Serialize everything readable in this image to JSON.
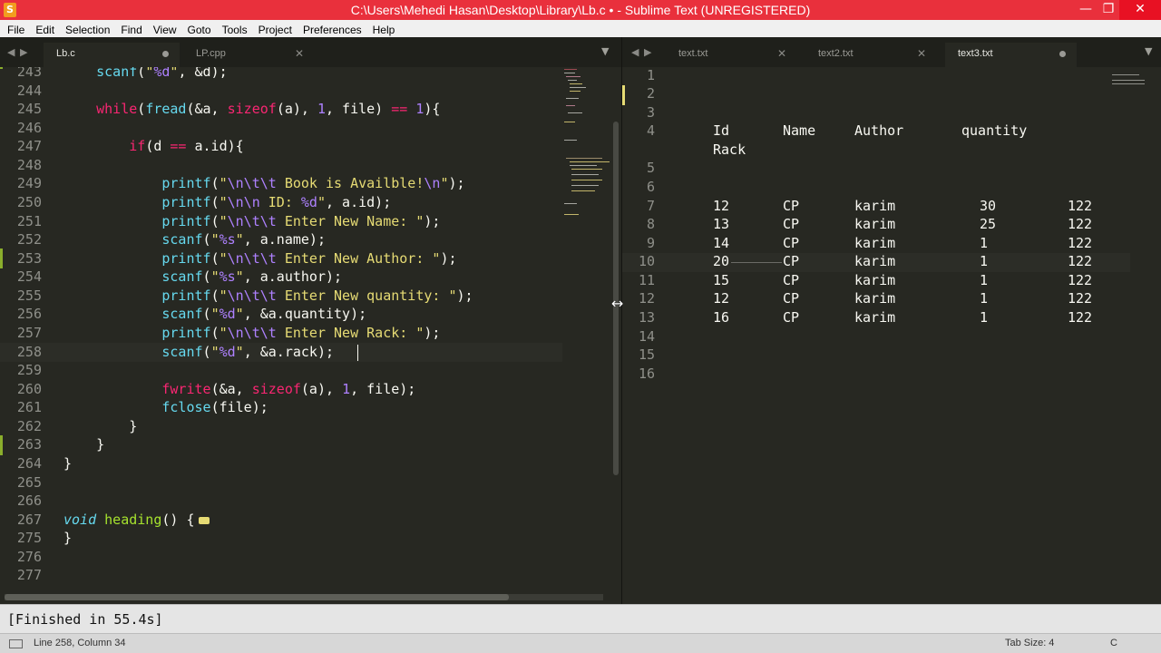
{
  "window": {
    "title": "C:\\Users\\Mehedi Hasan\\Desktop\\Library\\Lb.c • - Sublime Text (UNREGISTERED)",
    "app_icon": "S",
    "minimize": "—",
    "maximize": "❐",
    "close": "✕"
  },
  "menu": [
    "File",
    "Edit",
    "Selection",
    "Find",
    "View",
    "Goto",
    "Tools",
    "Project",
    "Preferences",
    "Help"
  ],
  "left_group": {
    "nav_prev": "◀",
    "nav_next": "▶",
    "dropdown": "▼",
    "tabs": [
      {
        "label": "Lb.c",
        "active": true,
        "dirty": true
      },
      {
        "label": "LP.cpp",
        "active": false,
        "dirty": false
      }
    ]
  },
  "right_group": {
    "nav_prev": "◀",
    "nav_next": "▶",
    "dropdown": "▼",
    "tabs": [
      {
        "label": "text.txt",
        "active": false,
        "dirty": false
      },
      {
        "label": "text2.txt",
        "active": false,
        "dirty": false
      },
      {
        "label": "text3.txt",
        "active": true,
        "dirty": true
      }
    ]
  },
  "left_editor": {
    "line_numbers": [
      "243",
      "244",
      "245",
      "246",
      "247",
      "248",
      "249",
      "250",
      "251",
      "252",
      "253",
      "254",
      "255",
      "256",
      "257",
      "258",
      "259",
      "260",
      "261",
      "262",
      "263",
      "264",
      "265",
      "266",
      "267",
      "275",
      "276",
      "277"
    ],
    "current_line": "258"
  },
  "right_editor": {
    "line_numbers": [
      "1",
      "2",
      "3",
      "4",
      "5",
      "6",
      "7",
      "8",
      "9",
      "10",
      "11",
      "12",
      "13",
      "14",
      "15",
      "16"
    ],
    "header_row1": [
      "Id",
      "Name",
      "Author",
      "quantity"
    ],
    "header_row2": "Rack",
    "rows": [
      [
        "12",
        "CP",
        "karim",
        "30",
        "122"
      ],
      [
        "13",
        "CP",
        "karim",
        "25",
        "122"
      ],
      [
        "14",
        "CP",
        "karim",
        "1",
        "122"
      ],
      [
        "20",
        "CP",
        "karim",
        "1",
        "122"
      ],
      [
        "15",
        "CP",
        "karim",
        "1",
        "122"
      ],
      [
        "12",
        "CP",
        "karim",
        "1",
        "122"
      ],
      [
        "16",
        "CP",
        "karim",
        "1",
        "122"
      ]
    ],
    "current_line": "10"
  },
  "output": {
    "text": "[Finished in 55.4s]"
  },
  "status": {
    "position": "Line 258, Column 34",
    "tab_size": "Tab Size: 4",
    "syntax": "C"
  },
  "colors": {
    "titlebar": "#e9303c",
    "editor_bg": "#272822",
    "keyword": "#f92672",
    "string": "#e6db74",
    "number": "#ae81ff",
    "function": "#66d9ef",
    "name": "#a6e22e"
  }
}
